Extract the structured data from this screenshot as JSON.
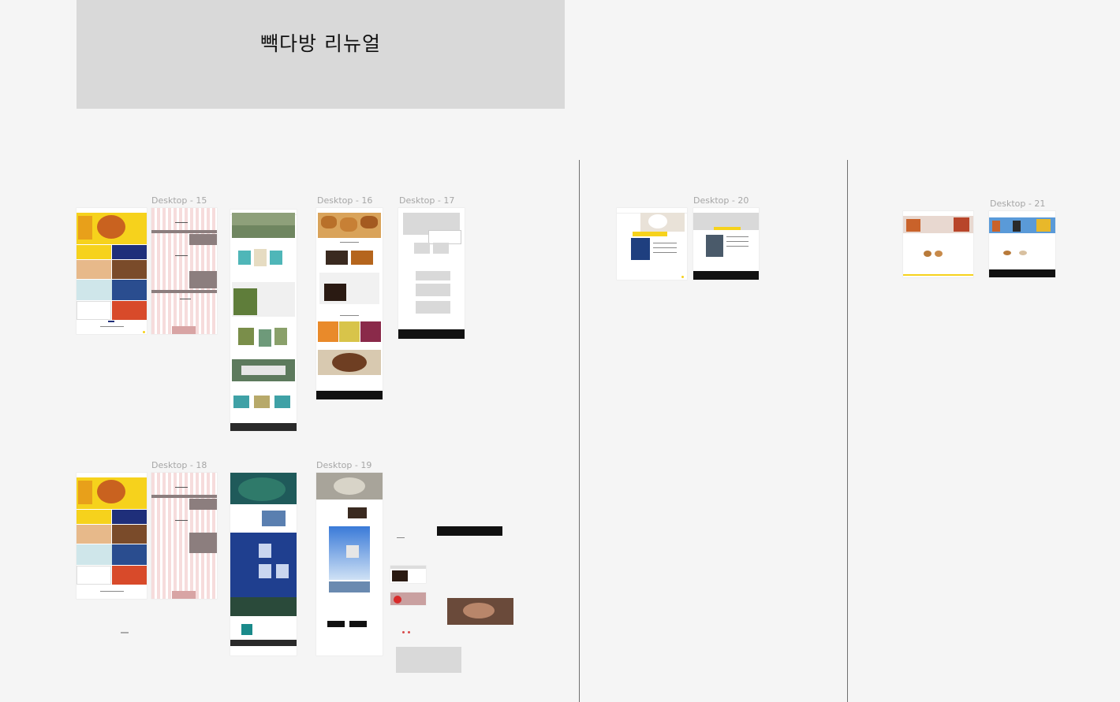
{
  "board": {
    "title": "빽다방 리뉴얼",
    "frames": [
      {
        "id": "d15",
        "label": "Desktop - 15"
      },
      {
        "id": "d16",
        "label": "Desktop - 16"
      },
      {
        "id": "d17",
        "label": "Desktop - 17"
      },
      {
        "id": "d18",
        "label": "Desktop - 18"
      },
      {
        "id": "d19",
        "label": "Desktop - 19"
      },
      {
        "id": "d20",
        "label": "Desktop - 20"
      },
      {
        "id": "d21",
        "label": "Desktop - 21"
      }
    ]
  },
  "colors": {
    "canvas": "#f5f5f5",
    "card": "#d9d9d9",
    "brand_yellow": "#f6d21c",
    "brand_navy": "#1f2f7a",
    "divider": "#6f6f6f",
    "label": "#a6a6a6"
  }
}
